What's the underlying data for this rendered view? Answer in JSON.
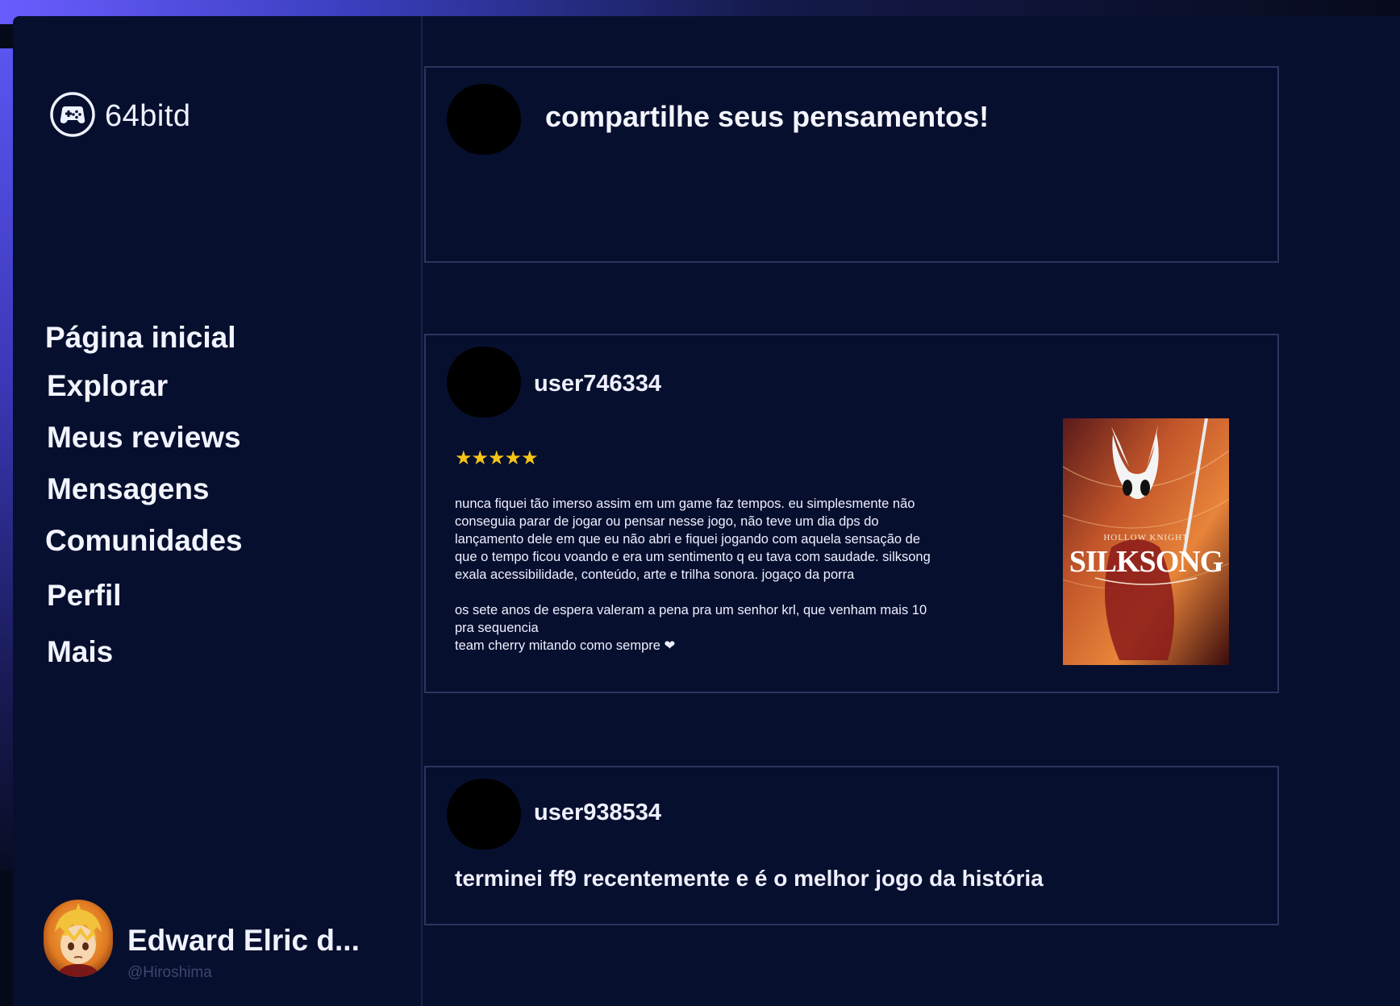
{
  "app": {
    "name": "64bitd",
    "logo_icon": "gamepad-icon"
  },
  "sidebar": {
    "items": [
      {
        "label": "Página inicial"
      },
      {
        "label": "Explorar"
      },
      {
        "label": "Meus reviews"
      },
      {
        "label": "Mensagens"
      },
      {
        "label": "Comunidades"
      },
      {
        "label": "Perfil"
      },
      {
        "label": "Mais"
      }
    ],
    "user": {
      "name": "Edward Elric d...",
      "handle": "@Hiroshima"
    }
  },
  "composer": {
    "placeholder": "compartilhe seus pensamentos!"
  },
  "posts": [
    {
      "username": "user746334",
      "rating_stars": "★★★★★",
      "rating": 5,
      "text": "nunca fiquei tão imerso assim em um game faz tempos. eu simplesmente não\nconseguia parar de jogar ou pensar nesse jogo, não teve um dia dps do\nlançamento dele em que eu não abri e fiquei jogando com aquela sensação de\nque o tempo ficou voando e era um sentimento q eu tava com saudade. silksong\nexala acessibilidade, conteúdo, arte e trilha sonora. jogaço da porra\n\nos sete anos de espera valeram a pena pra um senhor krl, que venham mais 10\npra sequencia\nteam cherry mitando como sempre ❤",
      "cover": {
        "subtitle": "HOLLOW KNIGHT",
        "title": "SILKSONG"
      }
    },
    {
      "username": "user938534",
      "text": "terminei ff9 recentemente e é o melhor jogo da história"
    }
  ],
  "colors": {
    "background": "#070f2e",
    "border": "#2b3560",
    "text": "#eef0ff",
    "star": "#f5c518",
    "accent_glow": "#6a5cff"
  }
}
